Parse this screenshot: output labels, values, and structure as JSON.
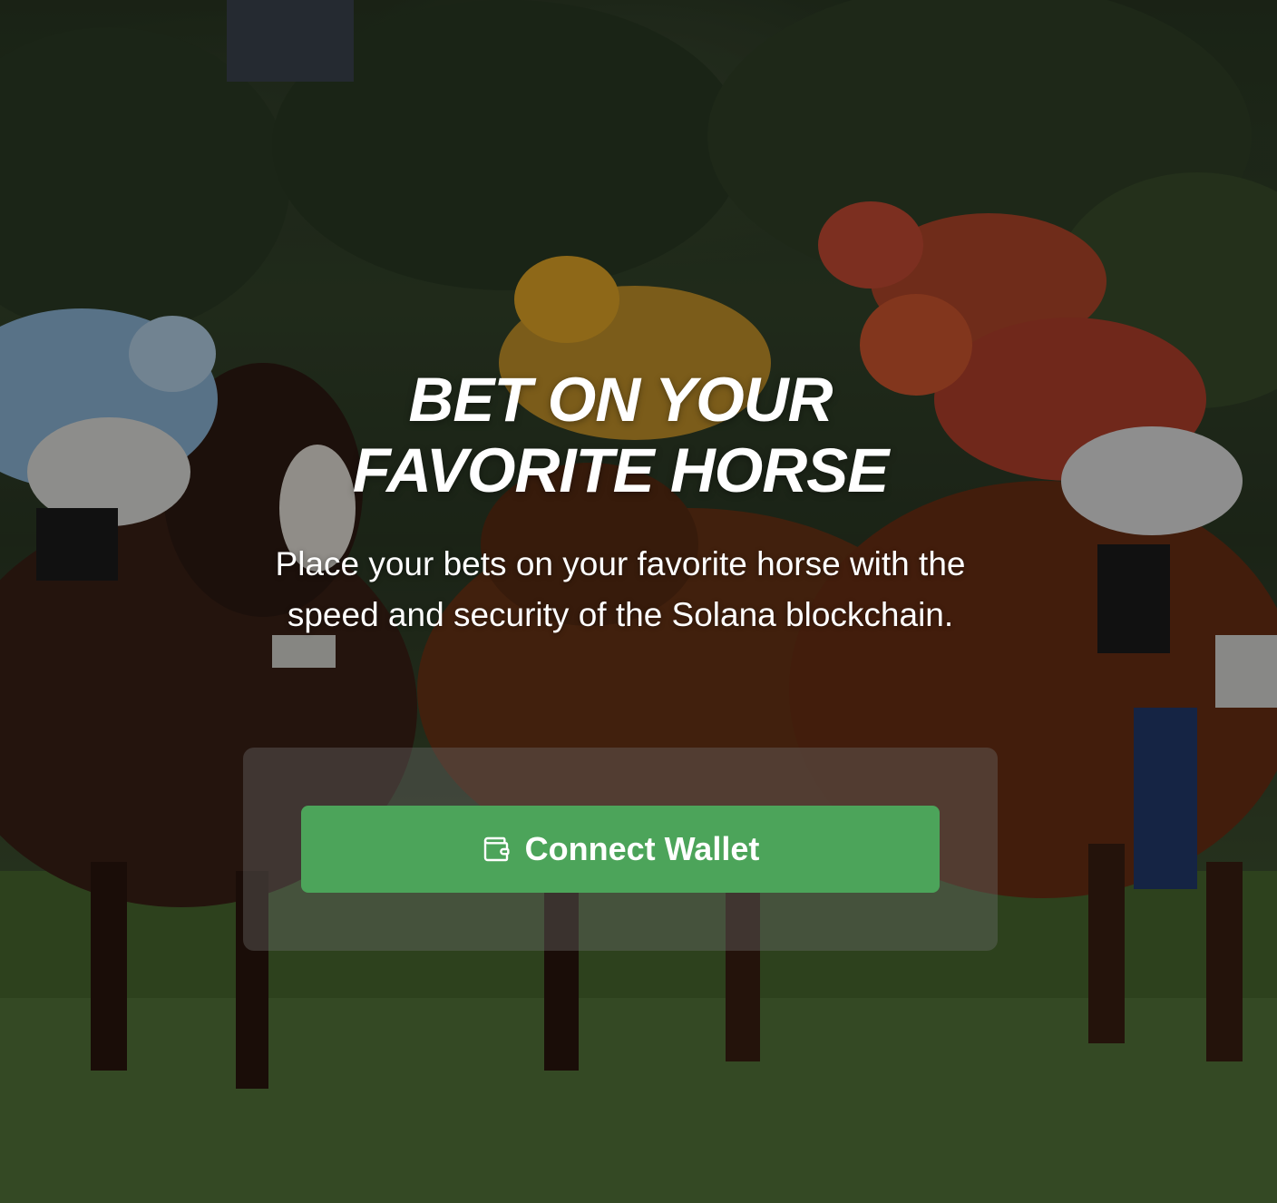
{
  "hero": {
    "title_line_1": "BET ON YOUR",
    "title_line_2": "FAVORITE HORSE",
    "subtitle": "Place your bets on your favorite horse with the speed and security of the Solana blockchain.",
    "background_image": "horse-race-photo",
    "accent_color": "#4ca45a"
  },
  "wallet_panel": {
    "connect_button_label": "Connect Wallet",
    "connect_button_icon": "wallet-icon"
  }
}
